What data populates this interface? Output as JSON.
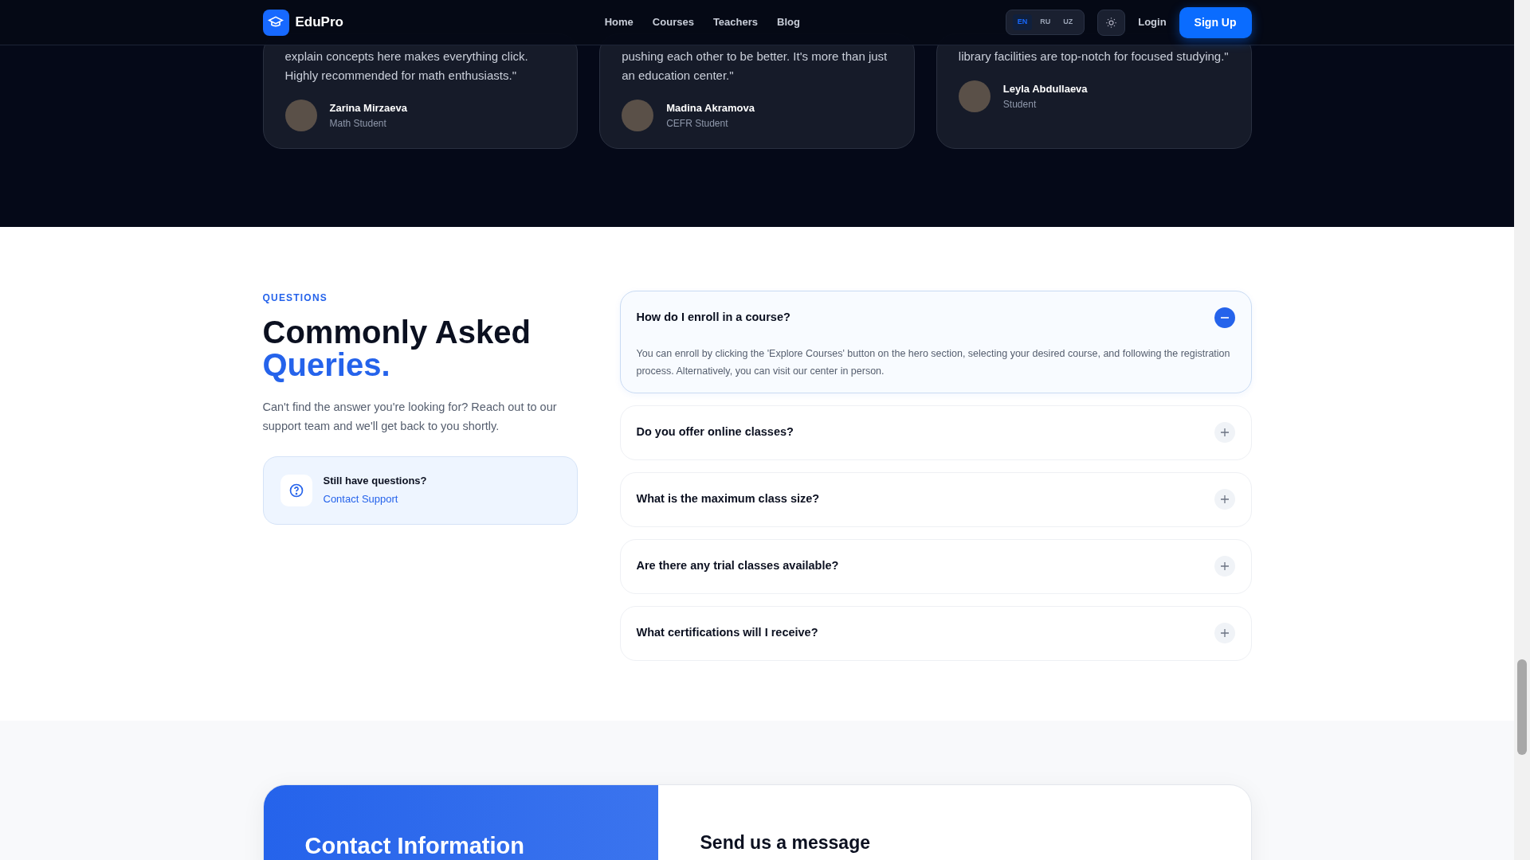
{
  "navbar": {
    "brand": "EduPro",
    "links": [
      {
        "label": "Home"
      },
      {
        "label": "Courses"
      },
      {
        "label": "Teachers"
      },
      {
        "label": "Blog"
      }
    ],
    "languages": [
      {
        "label": "EN",
        "selected": true
      },
      {
        "label": "RU",
        "selected": false
      },
      {
        "label": "UZ",
        "selected": false
      }
    ],
    "login": "Login",
    "signup": "Sign Up"
  },
  "testimonials": [
    {
      "quote": "explain concepts here makes everything click. Highly recommended for math enthusiasts.\"",
      "name": "Zarina Mirzaeva",
      "role": "Math Student"
    },
    {
      "quote": "pushing each other to be better. It's more than just an education center.\"",
      "name": "Madina Akramova",
      "role": "CEFR Student"
    },
    {
      "quote": "library facilities are top-notch for focused studying.\"",
      "name": "Leyla Abdullaeva",
      "role": "Student"
    }
  ],
  "faq": {
    "eyebrow": "QUESTIONS",
    "title": "Commonly Asked",
    "title_accent": "Queries.",
    "intro": "Can't find the answer you're looking for? Reach out to our support team and we'll get back to you shortly.",
    "help_card": {
      "title": "Still have questions?",
      "link": "Contact Support"
    },
    "items": [
      {
        "question": "How do I enroll in a course?",
        "expanded": true,
        "answer": "You can enroll by clicking the 'Explore Courses' button on the hero section, selecting your desired course, and following the registration process. Alternatively, you can visit our center in person."
      },
      {
        "question": "Do you offer online classes?",
        "expanded": false
      },
      {
        "question": "What is the maximum class size?",
        "expanded": false
      },
      {
        "question": "Are there any trial classes available?",
        "expanded": false
      },
      {
        "question": "What certifications will I receive?",
        "expanded": false
      }
    ]
  },
  "contact": {
    "info_title": "Contact Information",
    "form_title": "Send us a message"
  }
}
